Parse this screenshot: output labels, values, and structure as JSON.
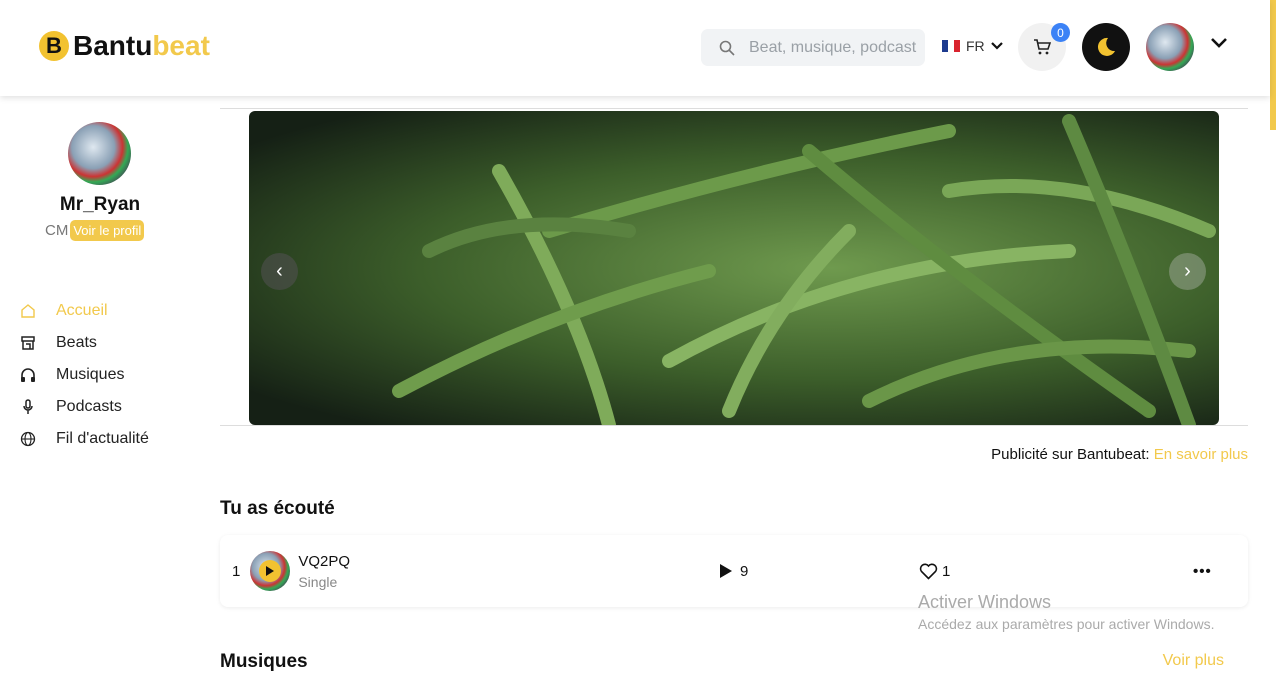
{
  "header": {
    "logo_dark": "Bantu",
    "logo_light": "beat",
    "search_placeholder": "Beat, musique, podcast",
    "lang": "FR",
    "cart_count": "0"
  },
  "profile": {
    "name": "Mr_Ryan",
    "country": "CM",
    "view_profile": "Voir le profil"
  },
  "nav": [
    {
      "label": "Accueil",
      "icon": "home-icon"
    },
    {
      "label": "Beats",
      "icon": "store-icon"
    },
    {
      "label": "Musiques",
      "icon": "headphones-icon"
    },
    {
      "label": "Podcasts",
      "icon": "mic-icon"
    },
    {
      "label": "Fil d'actualité",
      "icon": "globe-icon"
    }
  ],
  "ad": {
    "text": "Publicité sur Bantubeat:",
    "link": "En savoir plus"
  },
  "recent": {
    "title": "Tu as écouté",
    "items": [
      {
        "rank": "1",
        "title": "VQ2PQ",
        "type": "Single",
        "plays": "9",
        "likes": "1"
      }
    ]
  },
  "music": {
    "title": "Musiques",
    "more": "Voir plus"
  },
  "watermark": {
    "title": "Activer Windows",
    "sub": "Accédez aux paramètres pour activer Windows."
  },
  "colors": {
    "accent": "#f2c94c"
  }
}
